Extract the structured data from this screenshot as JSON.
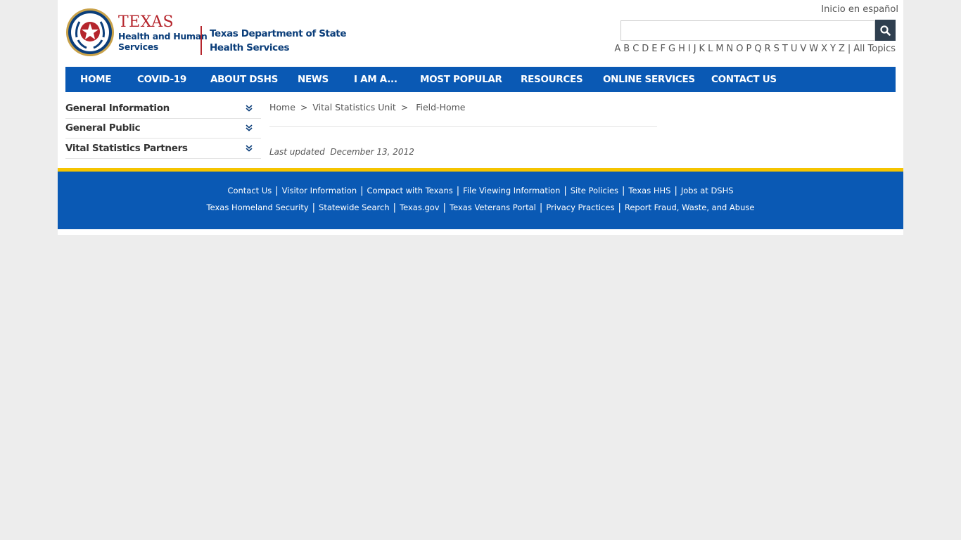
{
  "header": {
    "hhs_texas": "TEXAS",
    "hhs_line1": "Health and Human",
    "hhs_line2": "Services",
    "dshs_line1": "Texas Department of State",
    "dshs_line2": "Health Services",
    "lang_link": "Inicio en español",
    "search_placeholder": "",
    "alphabet": [
      "A",
      "B",
      "C",
      "D",
      "E",
      "F",
      "G",
      "H",
      "I",
      "J",
      "K",
      "L",
      "M",
      "N",
      "O",
      "P",
      "Q",
      "R",
      "S",
      "T",
      "U",
      "V",
      "W",
      "X",
      "Y",
      "Z"
    ],
    "all_topics": "All Topics"
  },
  "nav": {
    "items": [
      "HOME",
      "COVID-19",
      "ABOUT DSHS",
      "NEWS",
      "I AM A...",
      "MOST POPULAR",
      "RESOURCES",
      "ONLINE SERVICES",
      "CONTACT US"
    ]
  },
  "sidebar": {
    "items": [
      "General Information",
      "General Public",
      "Vital Statistics Partners"
    ]
  },
  "breadcrumb": {
    "home": "Home",
    "unit": "Vital Statistics Unit",
    "current": "Field-Home"
  },
  "updated": {
    "label": "Last updated",
    "date": "December 13, 2012"
  },
  "footer": {
    "row1": [
      "Contact Us",
      "Visitor Information",
      "Compact with Texans",
      "File Viewing Information",
      "Site Policies",
      "Texas HHS",
      "Jobs at DSHS"
    ],
    "row2": [
      "Texas Homeland Security",
      "Statewide Search",
      "Texas.gov",
      "Texas Veterans Portal",
      "Privacy Practices",
      "Report Fraud, Waste, and Abuse"
    ]
  },
  "colors": {
    "nav_blue": "#0a59b4",
    "footer_gold": "#f5c400",
    "brand_red": "#b5252c",
    "brand_navy": "#0b3e7a"
  }
}
